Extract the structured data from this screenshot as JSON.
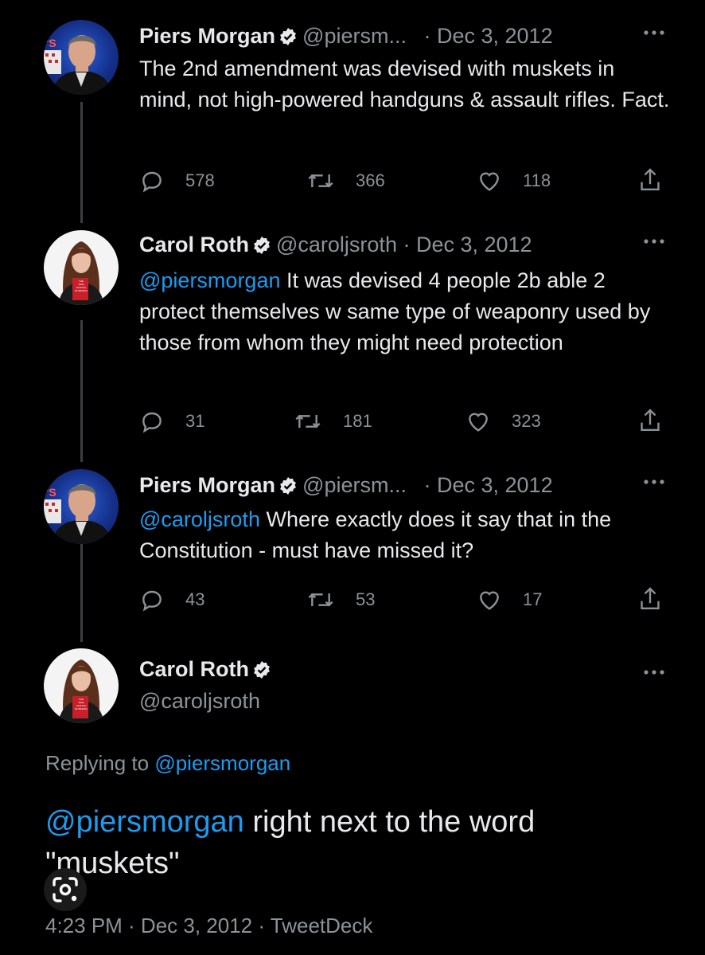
{
  "tweets": [
    {
      "name": "Piers Morgan",
      "handle": "@piersm...",
      "date": "· Dec 3, 2012",
      "mention": "",
      "text": "The 2nd amendment was devised with muskets in mind, not high-powered handguns & assault rifles. Fact.",
      "replies": "578",
      "retweets": "366",
      "likes": "118"
    },
    {
      "name": "Carol Roth",
      "handle": "@caroljsroth",
      "date": "· Dec 3, 2012",
      "mention": "@piersmorgan",
      "text": " It was devised 4 people 2b able 2 protect themselves w same type of weaponry used by those from whom they might need protection",
      "replies": "31",
      "retweets": "181",
      "likes": "323"
    },
    {
      "name": "Piers Morgan",
      "handle": "@piersm...",
      "date": "· Dec 3, 2012",
      "mention": "@caroljsroth",
      "text": " Where exactly does it say that in the Constitution - must have missed it?",
      "replies": "43",
      "retweets": "53",
      "likes": "17"
    }
  ],
  "focused": {
    "name": "Carol Roth",
    "handle": "@caroljsroth",
    "replying_prefix": "Replying to ",
    "replying_handle": "@piersmorgan",
    "mention": "@piersmorgan",
    "text": " right next to the word \"muskets\"",
    "timestamp": "4:23 PM · Dec 3, 2012 · TweetDeck"
  },
  "avatar_book": [
    "THE",
    "SIDE",
    "HUSTLE",
    "BUSINESS"
  ],
  "colors": {
    "accent": "#1d9bf0",
    "muted": "#8b9399",
    "text": "#e7e9ea",
    "background": "#000000"
  }
}
